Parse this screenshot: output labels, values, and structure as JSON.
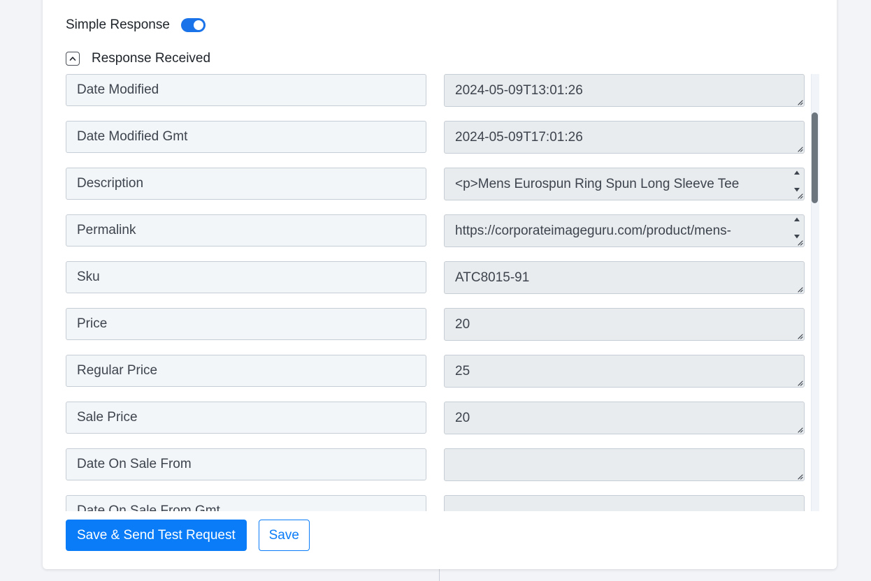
{
  "settings": {
    "simple_response_label": "Simple Response",
    "simple_response_on": true,
    "response_section_label": "Response Received"
  },
  "colors": {
    "accent": "#0a7cf7",
    "toggle": "#1a73e8",
    "key_bg": "#f3f6f9",
    "value_bg": "#e9ecef"
  },
  "response_rows": [
    {
      "key": "Date Modified",
      "value": "2024-05-09T13:01:26",
      "spinner": false
    },
    {
      "key": "Date Modified Gmt",
      "value": "2024-05-09T17:01:26",
      "spinner": false
    },
    {
      "key": "Description",
      "value": "<p>Mens Eurospun Ring Spun Long Sleeve Tee",
      "spinner": true
    },
    {
      "key": "Permalink",
      "value": "https://corporateimageguru.com/product/mens-",
      "spinner": true
    },
    {
      "key": "Sku",
      "value": "ATC8015-91",
      "spinner": false
    },
    {
      "key": "Price",
      "value": "20",
      "spinner": false
    },
    {
      "key": "Regular Price",
      "value": "25",
      "spinner": false
    },
    {
      "key": "Sale Price",
      "value": "20",
      "spinner": false
    },
    {
      "key": "Date On Sale From",
      "value": "",
      "spinner": false
    },
    {
      "key": "Date On Sale From Gmt",
      "value": "",
      "spinner": false
    }
  ],
  "actions": {
    "save_send_label": "Save & Send Test Request",
    "save_label": "Save"
  }
}
